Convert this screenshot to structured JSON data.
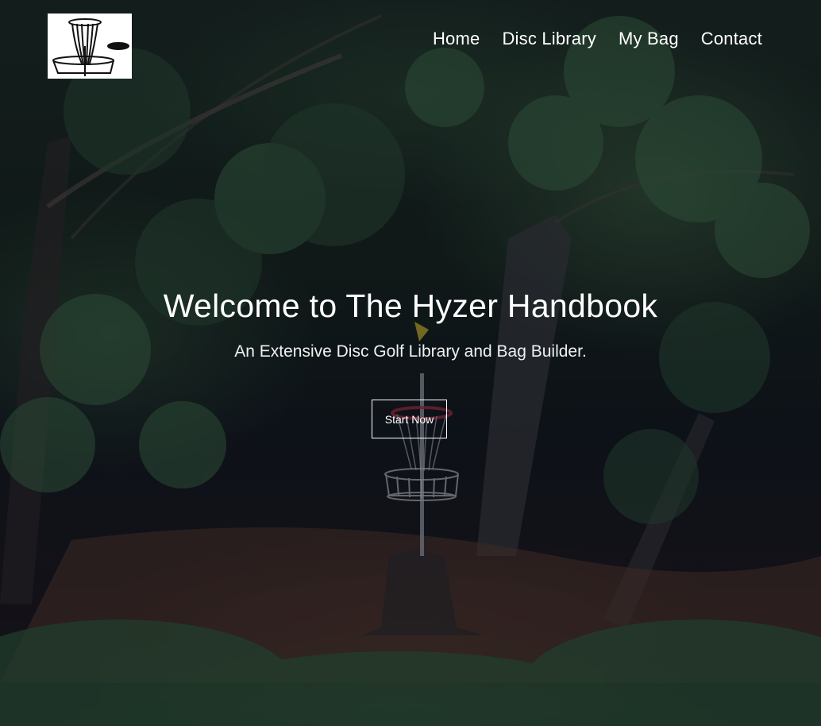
{
  "header": {
    "logo_icon": "disc-golf-basket-icon",
    "nav": [
      {
        "label": "Home"
      },
      {
        "label": "Disc Library"
      },
      {
        "label": "My Bag"
      },
      {
        "label": "Contact"
      }
    ]
  },
  "hero": {
    "title": "Welcome to The Hyzer Handbook",
    "subtitle": "An Extensive Disc Golf Library and Bag Builder.",
    "cta_label": "Start Now"
  },
  "colors": {
    "text": "#ffffff",
    "overlay": "#080a16",
    "foliage": "#2f5a38",
    "ground": "#5a3c2c"
  }
}
